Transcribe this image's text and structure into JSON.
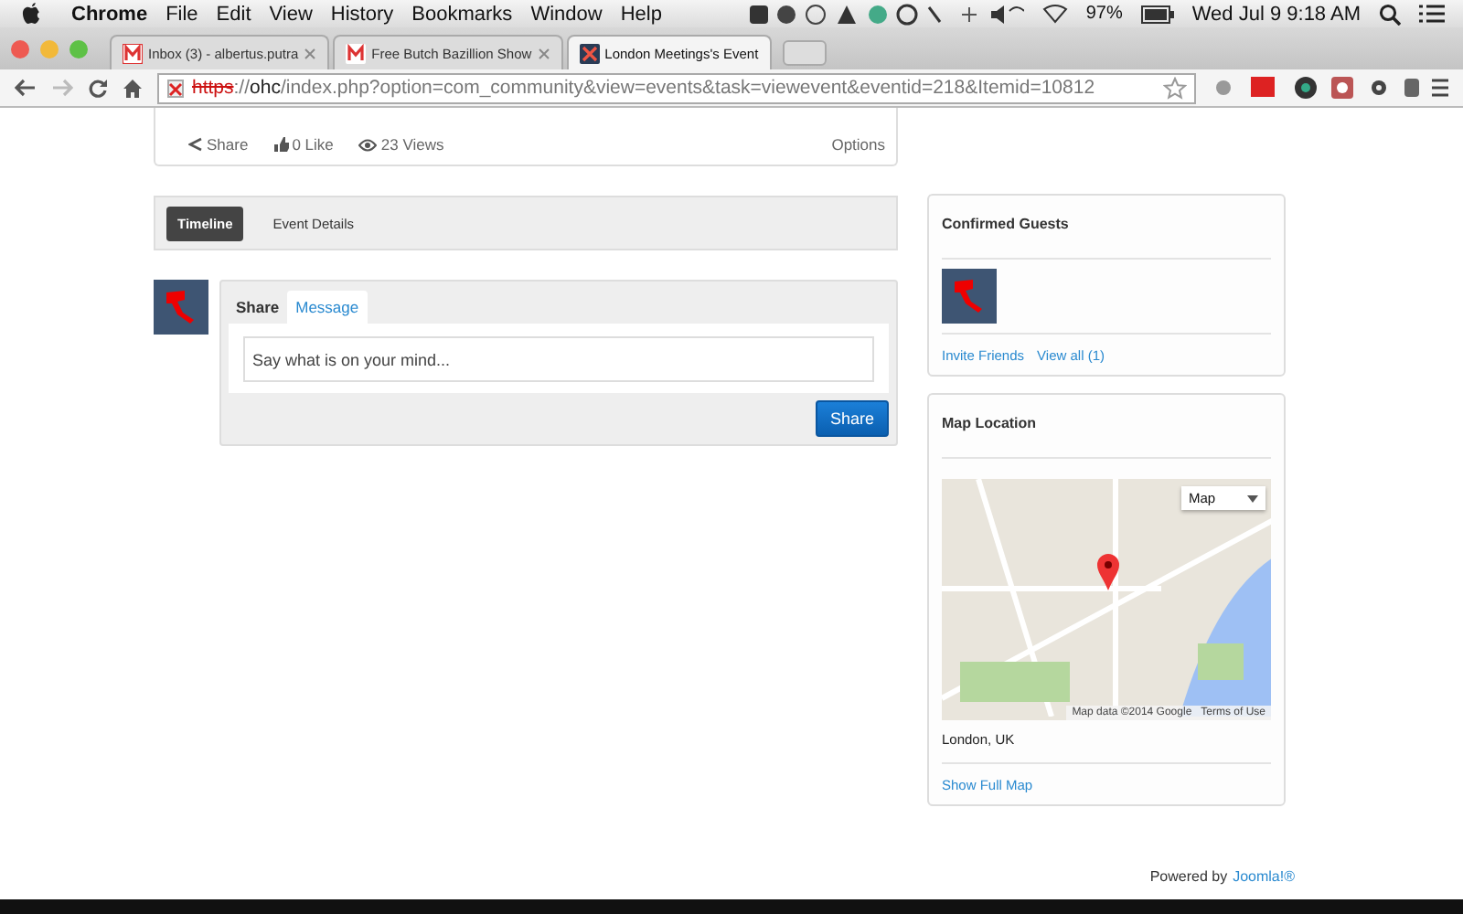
{
  "menu_bar": {
    "app": "Chrome",
    "items": [
      "File",
      "Edit",
      "View",
      "History",
      "Bookmarks",
      "Window",
      "Help"
    ],
    "battery": "97%",
    "datetime": "Wed Jul 9  9:18 AM"
  },
  "tabs": [
    {
      "title": "Inbox (3) - albertus.putra",
      "selected": false
    },
    {
      "title": "Free Butch Bazillion Show",
      "selected": false
    },
    {
      "title": "London Meetings's Event",
      "selected": true
    }
  ],
  "address_bar": {
    "url_parts": [
      {
        "text": "https",
        "kind": "scheme"
      },
      {
        "text": "://",
        "kind": "plain"
      },
      {
        "text": "ohc",
        "kind": "host"
      },
      {
        "text": "/index.php?option=com_community&view=events&task=viewevent&eventid=218&Itemid=10812",
        "kind": "plain"
      }
    ]
  },
  "event_stats": {
    "items": [
      {
        "kind": "share",
        "label": "Share"
      },
      {
        "kind": "like",
        "label": "0 Like"
      },
      {
        "kind": "views",
        "label": "23 Views"
      }
    ],
    "options": "Options"
  },
  "event_tabs": [
    {
      "label": "Timeline",
      "selected": true
    },
    {
      "label": "Event Details",
      "selected": false
    }
  ],
  "composer": {
    "label": "Share",
    "tabs": [
      {
        "label": "Message",
        "selected": true
      }
    ],
    "placeholder": "Say what is on your mind...",
    "button": "Share"
  },
  "guests": {
    "title": "Confirmed Guests",
    "links": [
      "Invite Friends",
      "View all (1)"
    ]
  },
  "map": {
    "title": "Map Location",
    "map_type": "Map",
    "attribution": "Map data ©2014 Google",
    "terms": "Terms of Use",
    "location": "London, UK",
    "link": "Show Full Map"
  },
  "footer": {
    "text": "Powered by",
    "link": "Joomla!®"
  }
}
